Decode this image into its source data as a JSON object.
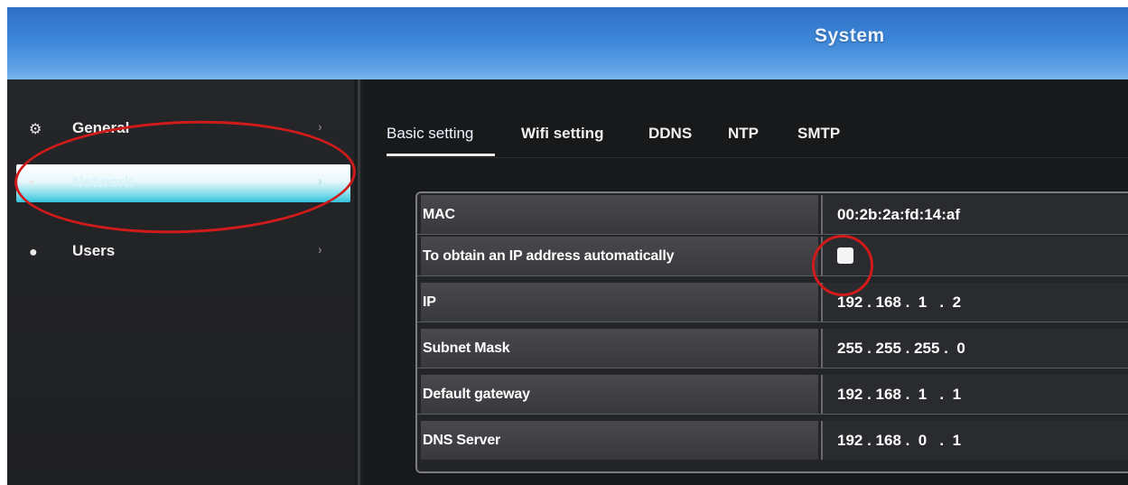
{
  "header": {
    "title": "System"
  },
  "sidebar": {
    "items": [
      {
        "label": "General",
        "icon": "gears-icon",
        "active": false
      },
      {
        "label": "Network",
        "icon": "network-icon",
        "active": true
      },
      {
        "label": "Users",
        "icon": "users-icon",
        "active": false
      }
    ],
    "chevron": "›"
  },
  "tabs": [
    {
      "label": "Basic setting",
      "active": true
    },
    {
      "label": "Wifi setting",
      "active": false
    },
    {
      "label": "DDNS",
      "active": false
    },
    {
      "label": "NTP",
      "active": false
    },
    {
      "label": "SMTP",
      "active": false
    }
  ],
  "network_table": {
    "rows": [
      {
        "label": "MAC",
        "value": "00:2b:2a:fd:14:af"
      },
      {
        "label": "To obtain an IP address automatically",
        "value": "",
        "checkbox": true,
        "checked": false
      },
      {
        "label": "IP",
        "value": "192 . 168 .  1   .  2"
      },
      {
        "label": "Subnet Mask",
        "value": "255 . 255 . 255 .  0"
      },
      {
        "label": "Default gateway",
        "value": "192 . 168 .  1   .  1"
      },
      {
        "label": "DNS Server",
        "value": "192 . 168 .  0   .  1"
      }
    ]
  },
  "colors": {
    "header_blue": "#3c86d8",
    "active_item": "#34c2d9",
    "annotation_red": "#d11a1a"
  }
}
